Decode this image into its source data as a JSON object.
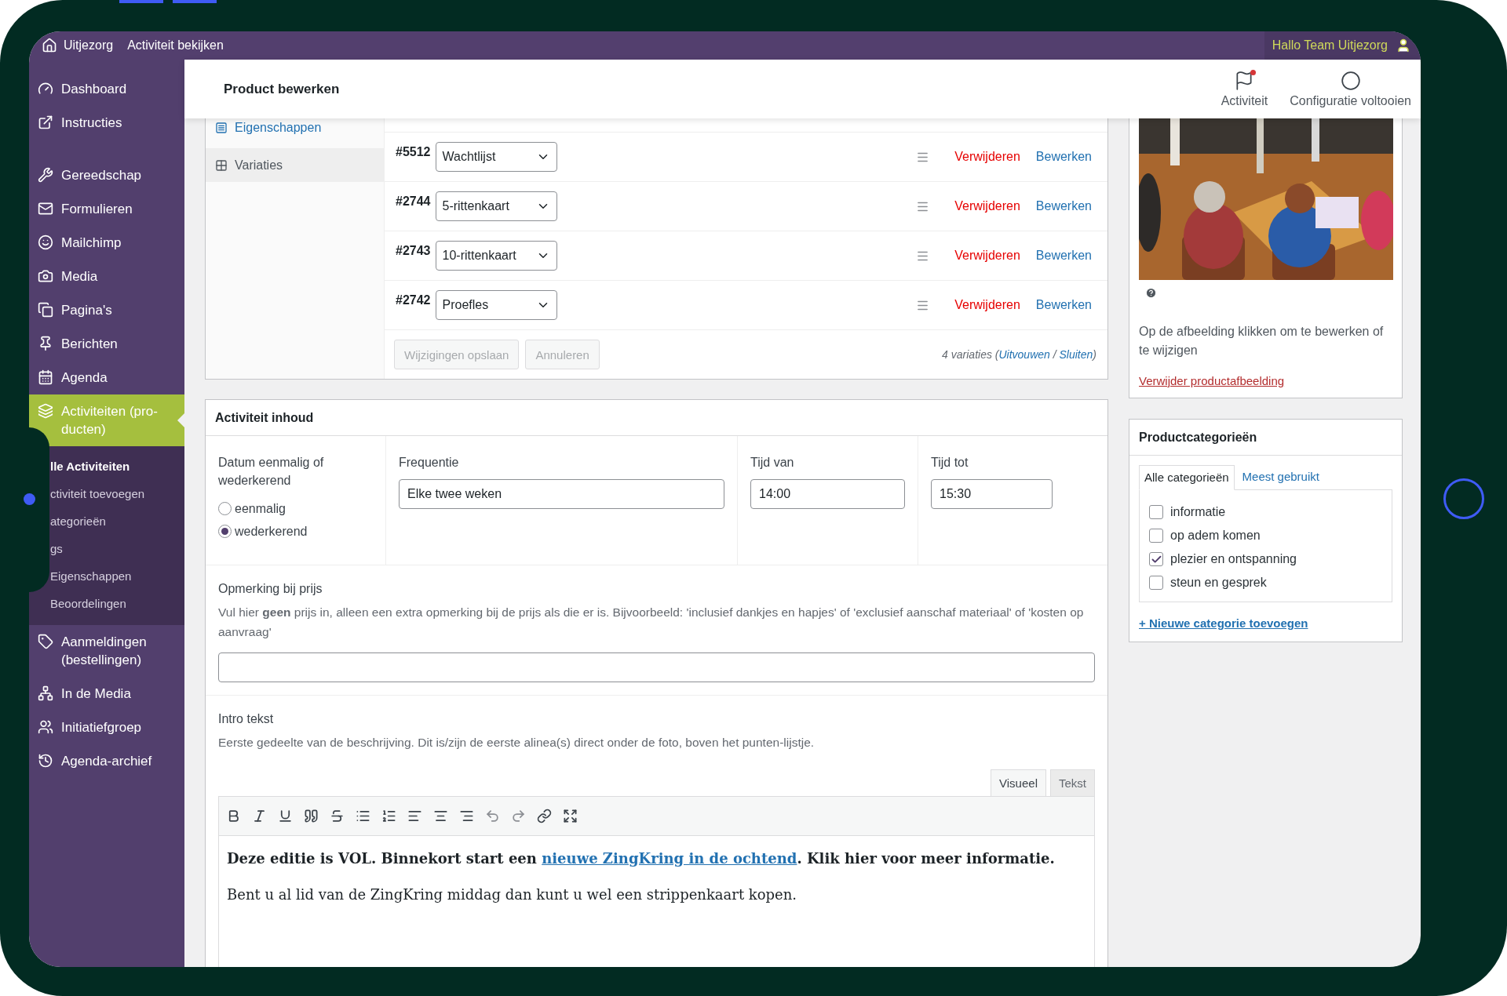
{
  "admin_bar": {
    "site": "Uitjezorg",
    "view_link": "Activiteit bekijken",
    "greeting": "Hallo Team Uitjezorg"
  },
  "sidebar": {
    "groups": [
      [
        {
          "label": "Dashboard",
          "selected": false
        },
        {
          "label": "Instructies",
          "selected": false
        }
      ],
      [
        {
          "label": "Gereedschap",
          "selected": false
        },
        {
          "label": "Formulieren",
          "selected": false
        },
        {
          "label": "Mailchimp",
          "selected": false
        },
        {
          "label": "Media",
          "selected": false
        },
        {
          "label": "Pagina's",
          "selected": false
        },
        {
          "label": "Berichten",
          "selected": false
        },
        {
          "label": "Agenda",
          "selected": false
        },
        {
          "label": "Activiteiten (pro-ducten)",
          "selected": true,
          "children": [
            {
              "label": "lle Activiteiten",
              "selected": true
            },
            {
              "label": "ctiviteit toevoegen",
              "selected": false
            },
            {
              "label": "ategorieën",
              "selected": false
            },
            {
              "label": "gs",
              "selected": false
            },
            {
              "label": "Eigenschappen",
              "selected": false
            },
            {
              "label": "Beoordelingen",
              "selected": false
            }
          ]
        },
        {
          "label": "Aanmeldingen (bestellingen)",
          "selected": false
        },
        {
          "label": "In de Media",
          "selected": false
        },
        {
          "label": "Initiatiefgroep",
          "selected": false
        },
        {
          "label": "Agenda-archief",
          "selected": false
        }
      ]
    ]
  },
  "header": {
    "title": "Product bewerken",
    "actions": [
      {
        "label": "Activiteit",
        "notification": true
      },
      {
        "label": "Configuratie voltooien",
        "notification": false
      }
    ]
  },
  "product_data": {
    "tabs": [
      {
        "label": "Eigenschappen",
        "selected": false
      },
      {
        "label": "Variaties",
        "selected": true
      }
    ],
    "variations": [
      {
        "id": "#5512",
        "value": "Wachtlijst",
        "remove": "Verwijderen",
        "edit": "Bewerken"
      },
      {
        "id": "#2744",
        "value": "5-rittenkaart",
        "remove": "Verwijderen",
        "edit": "Bewerken"
      },
      {
        "id": "#2743",
        "value": "10-rittenkaart",
        "remove": "Verwijderen",
        "edit": "Bewerken"
      },
      {
        "id": "#2742",
        "value": "Proefles",
        "remove": "Verwijderen",
        "edit": "Bewerken"
      }
    ],
    "buttons": [
      {
        "label": "Wijzigingen opslaan",
        "disabled": true
      },
      {
        "label": "Annuleren",
        "disabled": true
      }
    ],
    "summary": {
      "prefix": "4 variaties (",
      "expand": "Uitvouwen",
      "separator": " / ",
      "collapse": "Sluiten",
      "suffix": ")"
    }
  },
  "activity_content": {
    "title": "Activiteit inhoud",
    "date_type": {
      "label": "Datum eenmalig of wederkerend",
      "options": [
        {
          "label": "eenmalig",
          "selected": false
        },
        {
          "label": "wederkerend",
          "selected": true
        }
      ]
    },
    "frequency": {
      "label": "Frequentie",
      "value": "Elke twee weken"
    },
    "time_from": {
      "label": "Tijd van",
      "value": "14:00"
    },
    "time_to": {
      "label": "Tijd tot",
      "value": "15:30"
    },
    "price_note": {
      "label": "Opmerking bij prijs",
      "description": "Vul hier **geen** prijs in, alleen een extra opmerking bij de prijs als die er is. Bijvoorbeeld: 'inclusief dankjes en hapjes' of 'exclusief aanschaf materiaal' of 'kosten op aanvraag'"
    },
    "intro": {
      "label": "Intro tekst",
      "description": "Eerste gedeelte van de beschrijving. Dit is/zijn de eerste alinea(s) direct onder de foto, boven het punten-lijstje.",
      "editor_tabs": [
        {
          "label": "Visueel",
          "selected": true
        },
        {
          "label": "Tekst",
          "selected": false
        }
      ],
      "paragraphs": [
        {
          "bold": true,
          "before": "Deze editie is VOL. Binnekort start een ",
          "link": "nieuwe ZingKring in de ochtend",
          "after": ". Klik hier voor meer informatie."
        },
        {
          "bold": false,
          "before": "Bent u al lid van de ZingKring middag dan kunt u wel een strippenkaart kopen."
        }
      ]
    }
  },
  "featured_image": {
    "kind": "picture",
    "hint": "Op de afbeelding klikken om te bewerken of te wijzigen",
    "remove_link": "Verwijder productafbeelding"
  },
  "categories": {
    "title": "Productcategorieën",
    "tabs": [
      {
        "label": "Alle categorieën",
        "selected": true
      },
      {
        "label": "Meest gebruikt",
        "selected": false
      }
    ],
    "items": [
      {
        "label": "informatie",
        "checked": false
      },
      {
        "label": "op adem komen",
        "checked": false
      },
      {
        "label": "plezier en ontspanning",
        "checked": true
      },
      {
        "label": "steun en gesprek",
        "checked": false
      }
    ],
    "add_link": "+ Nieuwe categorie toevoegen"
  }
}
